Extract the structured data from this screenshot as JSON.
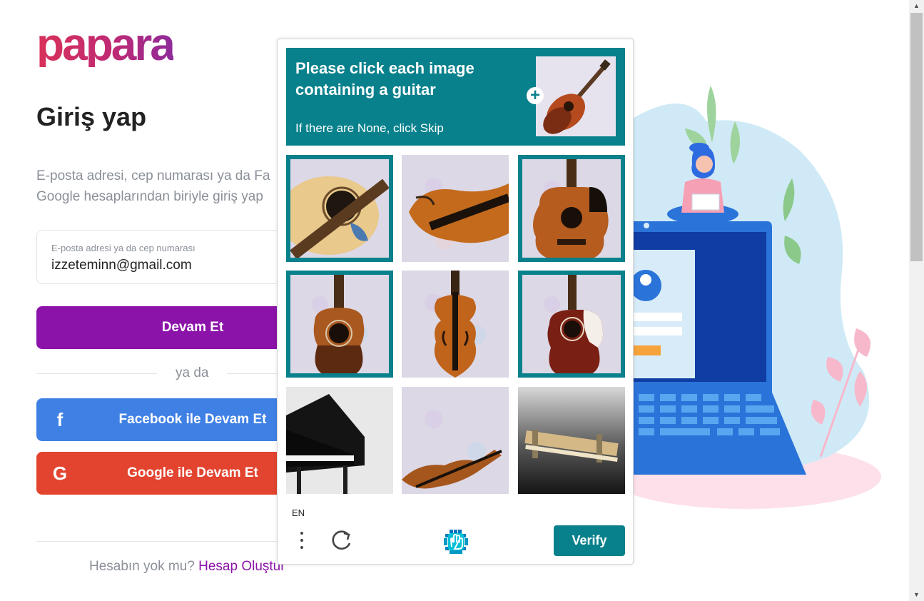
{
  "brand": {
    "logo_text": "papara",
    "accent": "#8c13a9"
  },
  "login": {
    "title": "Giriş yap",
    "description_line1": "E-posta adresi, cep numarası ya da Fa",
    "description_line2": "Google hesaplarından biriyle giriş yap",
    "email_label": "E-posta adresi ya da cep numarası",
    "email_value": "izzeteminn@gmail.com",
    "continue_label": "Devam Et",
    "or_label": "ya da",
    "facebook_label": "Facebook ile Devam Et",
    "facebook_icon": "f",
    "google_label": "Google ile Devam Et",
    "google_icon": "G",
    "no_account_text": "Hesabın yok mu?",
    "create_account_label": "Hesap Oluştur"
  },
  "captcha": {
    "prompt": "Please click each image containing a guitar",
    "sub": "If there are None, click Skip",
    "language": "EN",
    "verify_label": "Verify",
    "accent": "#08818c",
    "tiles": [
      {
        "subject": "acoustic-guitar-closeup",
        "selected": true
      },
      {
        "subject": "violin",
        "selected": false
      },
      {
        "subject": "acoustic-guitar-cutaway",
        "selected": true
      },
      {
        "subject": "acoustic-guitar",
        "selected": true
      },
      {
        "subject": "violin",
        "selected": false
      },
      {
        "subject": "acoustic-guitar-cutaway",
        "selected": true
      },
      {
        "subject": "grand-piano",
        "selected": false
      },
      {
        "subject": "violin",
        "selected": false
      },
      {
        "subject": "instrument-object",
        "selected": false
      }
    ]
  },
  "scrollbar": {
    "up_arrow": "▲",
    "down_arrow": "▼"
  }
}
